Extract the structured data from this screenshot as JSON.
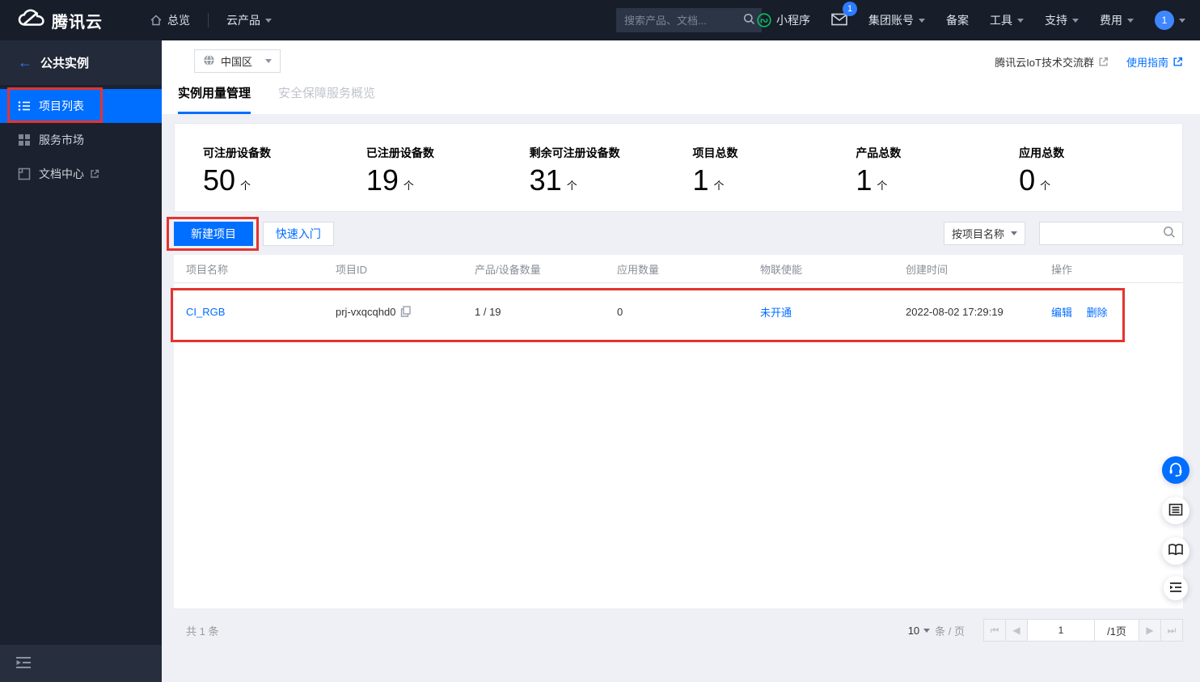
{
  "topbar": {
    "logo": "腾讯云",
    "overview": "总览",
    "products": "云产品",
    "search_placeholder": "搜索产品、文档...",
    "mini_program": "小程序",
    "mail_badge": "1",
    "group_account": "集团账号",
    "record": "备案",
    "tools": "工具",
    "support": "支持",
    "billing": "费用",
    "avatar": "1"
  },
  "sidebar": {
    "back": "公共实例",
    "items": [
      {
        "label": "项目列表"
      },
      {
        "label": "服务市场"
      },
      {
        "label": "文档中心"
      }
    ]
  },
  "header": {
    "region": "中国区",
    "tab_usage": "实例用量管理",
    "tab_security": "安全保障服务概览",
    "link_group": "腾讯云IoT技术交流群",
    "link_guide": "使用指南"
  },
  "stats": [
    {
      "label": "可注册设备数",
      "value": "50",
      "unit": "个"
    },
    {
      "label": "已注册设备数",
      "value": "19",
      "unit": "个"
    },
    {
      "label": "剩余可注册设备数",
      "value": "31",
      "unit": "个"
    },
    {
      "label": "项目总数",
      "value": "1",
      "unit": "个"
    },
    {
      "label": "产品总数",
      "value": "1",
      "unit": "个"
    },
    {
      "label": "应用总数",
      "value": "0",
      "unit": "个"
    }
  ],
  "toolbar": {
    "new_project": "新建项目",
    "quick_start": "快速入门",
    "filter": "按项目名称"
  },
  "table": {
    "columns": [
      "项目名称",
      "项目ID",
      "产品/设备数量",
      "应用数量",
      "物联使能",
      "创建时间",
      "操作"
    ],
    "row": {
      "name": "CI_RGB",
      "id": "prj-vxqcqhd0",
      "devices": "1 / 19",
      "apps": "0",
      "iot": "未开通",
      "created": "2022-08-02 17:29:19",
      "edit": "编辑",
      "delete": "删除"
    }
  },
  "footer": {
    "total": "共 1 条",
    "page_size": "10",
    "per_page": "条 / 页",
    "page": "1",
    "page_total": "/1页"
  },
  "colors": {
    "accent": "#006eff",
    "annotation": "#e5332e"
  }
}
